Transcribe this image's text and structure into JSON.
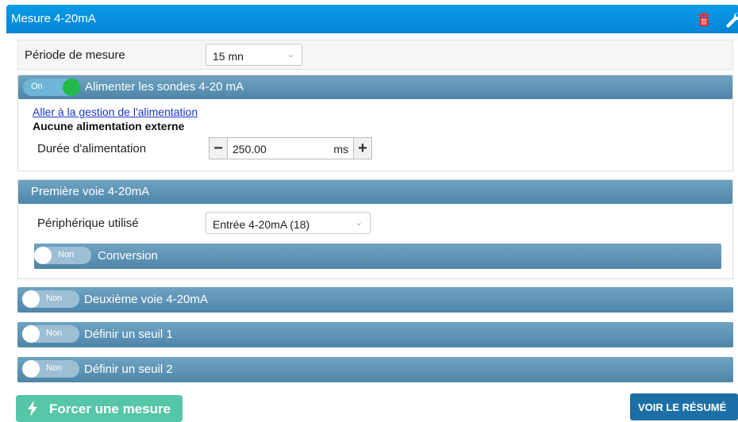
{
  "header": {
    "title": "Mesure 4-20mA",
    "icons": [
      "trash-icon",
      "wrench-icon"
    ]
  },
  "period": {
    "label": "Période de mesure",
    "selected": "15 mn"
  },
  "power": {
    "toggle_label": "On",
    "toggle_state": true,
    "title": "Alimenter les sondes 4-20 mA",
    "link": "Aller à la gestion de l'alimentation",
    "note": "Aucune alimentation externe",
    "duration_label": "Durée d'alimentation",
    "duration_value": "250.00",
    "duration_unit": "ms",
    "minus": "−",
    "plus": "+"
  },
  "channel1": {
    "title": "Première voie 4-20mA",
    "device_label": "Périphérique utilisé",
    "device_selected": "Entrée 4-20mA (18)",
    "conversion": {
      "toggle_label": "Non",
      "toggle_state": false,
      "title": "Conversion"
    }
  },
  "channel2": {
    "toggle_label": "Non",
    "toggle_state": false,
    "title": "Deuxième voie 4-20mA"
  },
  "threshold1": {
    "toggle_label": "Non",
    "toggle_state": false,
    "title": "Définir un seuil 1"
  },
  "threshold2": {
    "toggle_label": "Non",
    "toggle_state": false,
    "title": "Définir un seuil 2"
  },
  "actions": {
    "force": "Forcer une mesure",
    "summary": "VOIR LE RÉSUMÉ"
  },
  "colors": {
    "header": "#0a9be6",
    "band": "#5b90b0",
    "toggle_on": "#22bb4a",
    "force_button": "#55c6a7",
    "summary_button": "#1c6fa6",
    "trash": "#e03030"
  }
}
